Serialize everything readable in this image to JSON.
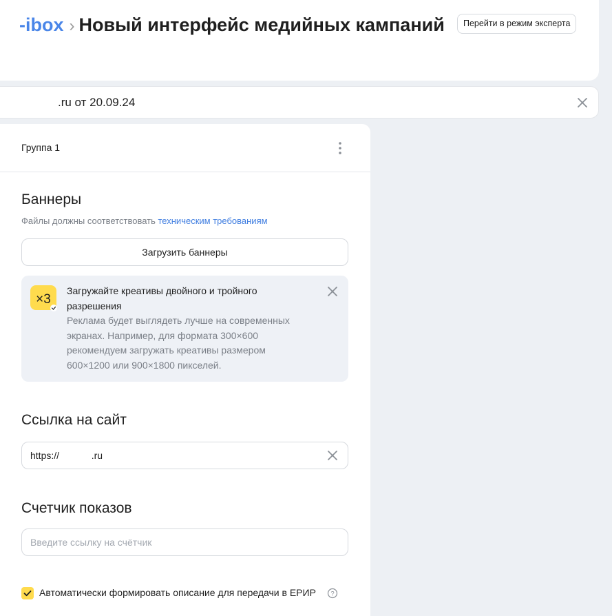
{
  "header": {
    "breadcrumb_link": "-ibox",
    "breadcrumb_separator": "›",
    "title": "Новый интерфейс медийных кампаний",
    "expert_mode_button": "Перейти в режим эксперта"
  },
  "campaign": {
    "name": ".ru от 20.09.24"
  },
  "group": {
    "title": "Группа 1"
  },
  "banners": {
    "title": "Баннеры",
    "hint_prefix": "Файлы должны соответствовать ",
    "hint_link": "техническим требованиям",
    "upload_button": "Загрузить баннеры"
  },
  "notice": {
    "badge_text": "×3",
    "title": "Загружайте креативы двойного и тройного разрешения",
    "text": "Реклама будет выглядеть лучше на современных экранах. Например, для формата 300×600 рекомендуем загружать креативы размером 600×1200 или 900×1800 пикселей."
  },
  "site_link": {
    "title": "Ссылка на сайт",
    "value": "https://            .ru"
  },
  "counter": {
    "title": "Счетчик показов",
    "placeholder": "Введите ссылку на счётчик"
  },
  "erir": {
    "checked": true,
    "label": "Автоматически формировать описание для передачи в ЕРИР"
  },
  "colors": {
    "accent_link": "#3f7de0",
    "checkbox_yellow": "#ffdb4d",
    "page_background": "#edf0f4",
    "notice_background": "#eef1f6"
  },
  "icons": {
    "campaign_close": "close-icon",
    "group_menu": "more-vertical-icon",
    "notice_close": "close-icon",
    "field_clear": "close-icon",
    "badge": "resolution-x3-icon",
    "checkbox": "checkmark-icon",
    "help": "question-circle-icon"
  }
}
